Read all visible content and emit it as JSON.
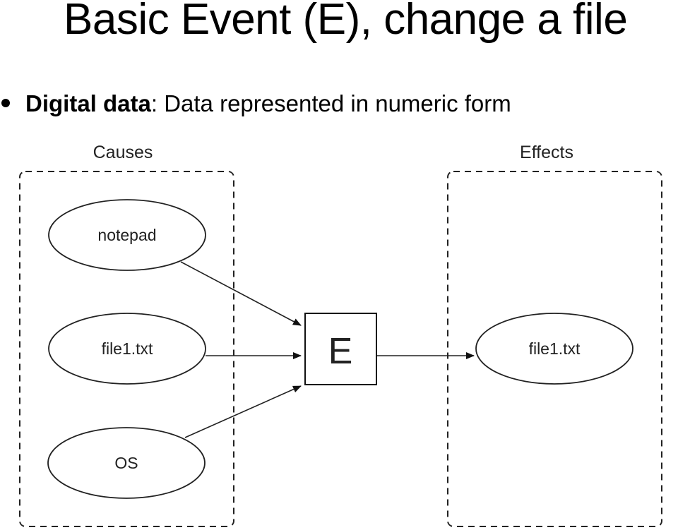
{
  "slide": {
    "title": "Basic Event (E), change a file",
    "bullet": {
      "term": "Digital data",
      "separator": ": ",
      "definition": "Data represented in numeric form"
    }
  },
  "diagram": {
    "groups": [
      {
        "id": "causes",
        "label": "Causes"
      },
      {
        "id": "effects",
        "label": "Effects"
      }
    ],
    "nodes": [
      {
        "id": "notepad",
        "label": "notepad",
        "shape": "ellipse",
        "group": "causes"
      },
      {
        "id": "file1_in",
        "label": "file1.txt",
        "shape": "ellipse",
        "group": "causes"
      },
      {
        "id": "os",
        "label": "OS",
        "shape": "ellipse",
        "group": "causes"
      },
      {
        "id": "event",
        "label": "E",
        "shape": "box"
      },
      {
        "id": "file1_out",
        "label": "file1.txt",
        "shape": "ellipse",
        "group": "effects"
      }
    ],
    "edges": [
      {
        "from": "notepad",
        "to": "event"
      },
      {
        "from": "file1_in",
        "to": "event"
      },
      {
        "from": "os",
        "to": "event"
      },
      {
        "from": "event",
        "to": "file1_out"
      }
    ]
  }
}
